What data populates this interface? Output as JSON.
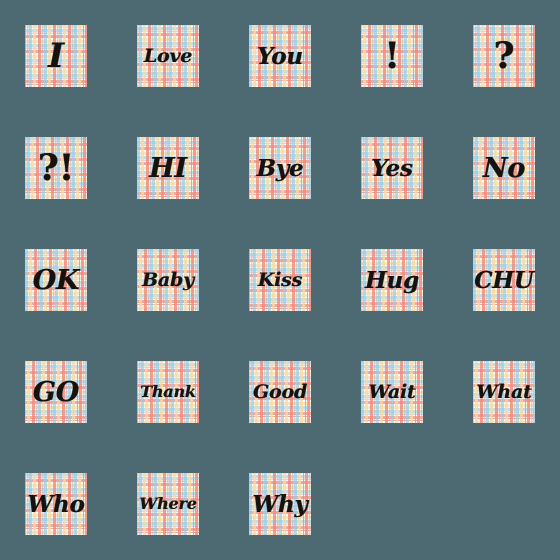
{
  "sheet": {
    "background_color": "#4d6a73",
    "tile_background": "plaid-check-pattern",
    "text_color": "#15120f",
    "columns": 5,
    "rows": 5,
    "tile_count": 23,
    "plaid_colors": {
      "base": "#fdfcfa",
      "salmon": "#f08a7a",
      "light_blue": "#96cde6",
      "cream": "#f6daa8",
      "grey_lavender": "#bab2be"
    }
  },
  "stickers": [
    {
      "id": "sticker-i",
      "label": "I",
      "row": 1,
      "col": 1
    },
    {
      "id": "sticker-love",
      "label": "Love",
      "row": 1,
      "col": 2
    },
    {
      "id": "sticker-you",
      "label": "You",
      "row": 1,
      "col": 3
    },
    {
      "id": "sticker-excl",
      "label": "!",
      "row": 1,
      "col": 4
    },
    {
      "id": "sticker-quest",
      "label": "?",
      "row": 1,
      "col": 5
    },
    {
      "id": "sticker-questexcl",
      "label": "?!",
      "row": 2,
      "col": 1
    },
    {
      "id": "sticker-hi",
      "label": "HI",
      "row": 2,
      "col": 2
    },
    {
      "id": "sticker-bye",
      "label": "Bye",
      "row": 2,
      "col": 3
    },
    {
      "id": "sticker-yes",
      "label": "Yes",
      "row": 2,
      "col": 4
    },
    {
      "id": "sticker-no",
      "label": "No",
      "row": 2,
      "col": 5
    },
    {
      "id": "sticker-ok",
      "label": "OK",
      "row": 3,
      "col": 1
    },
    {
      "id": "sticker-baby",
      "label": "Baby",
      "row": 3,
      "col": 2
    },
    {
      "id": "sticker-kiss",
      "label": "Kiss",
      "row": 3,
      "col": 3
    },
    {
      "id": "sticker-hug",
      "label": "Hug",
      "row": 3,
      "col": 4
    },
    {
      "id": "sticker-chu",
      "label": "CHU",
      "row": 3,
      "col": 5
    },
    {
      "id": "sticker-go",
      "label": "GO",
      "row": 4,
      "col": 1
    },
    {
      "id": "sticker-thank",
      "label": "Thank",
      "row": 4,
      "col": 2
    },
    {
      "id": "sticker-good",
      "label": "Good",
      "row": 4,
      "col": 3
    },
    {
      "id": "sticker-wait",
      "label": "Wait",
      "row": 4,
      "col": 4
    },
    {
      "id": "sticker-what",
      "label": "What",
      "row": 4,
      "col": 5
    },
    {
      "id": "sticker-who",
      "label": "Who",
      "row": 5,
      "col": 1
    },
    {
      "id": "sticker-where",
      "label": "Where",
      "row": 5,
      "col": 2
    },
    {
      "id": "sticker-why",
      "label": "Why",
      "row": 5,
      "col": 3
    }
  ]
}
